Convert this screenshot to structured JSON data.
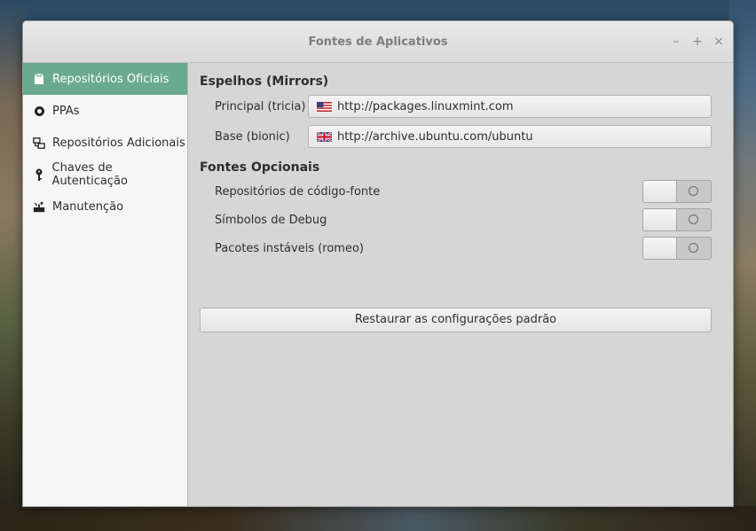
{
  "window": {
    "title": "Fontes de Aplicativos",
    "controls": {
      "minimize": "–",
      "maximize": "+",
      "close": "×"
    }
  },
  "sidebar": {
    "items": [
      {
        "label": "Repositórios Oficiais",
        "icon": "package-icon",
        "active": true
      },
      {
        "label": "PPAs",
        "icon": "ppa-icon",
        "active": false
      },
      {
        "label": "Repositórios Adicionais",
        "icon": "network-icon",
        "active": false
      },
      {
        "label": "Chaves de Autenticação",
        "icon": "key-icon",
        "active": false
      },
      {
        "label": "Manutenção",
        "icon": "tools-icon",
        "active": false
      }
    ]
  },
  "mirrors": {
    "title": "Espelhos (Mirrors)",
    "rows": [
      {
        "label": "Principal (tricia)",
        "url": "http://packages.linuxmint.com",
        "flag": "us-flag-icon"
      },
      {
        "label": "Base (bionic)",
        "url": "http://archive.ubuntu.com/ubuntu",
        "flag": "uk-flag-icon"
      }
    ]
  },
  "optional": {
    "title": "Fontes Opcionais",
    "rows": [
      {
        "label": "Repositórios de código-fonte",
        "enabled": false
      },
      {
        "label": "Símbolos de Debug",
        "enabled": false
      },
      {
        "label": "Pacotes instáveis (romeo)",
        "enabled": false
      }
    ]
  },
  "restore": {
    "label": "Restaurar as configurações padrão"
  },
  "colors": {
    "accent": "#6aaa8f",
    "sidebar_bg": "#f6f6f6",
    "content_bg": "#d6d6d6"
  }
}
